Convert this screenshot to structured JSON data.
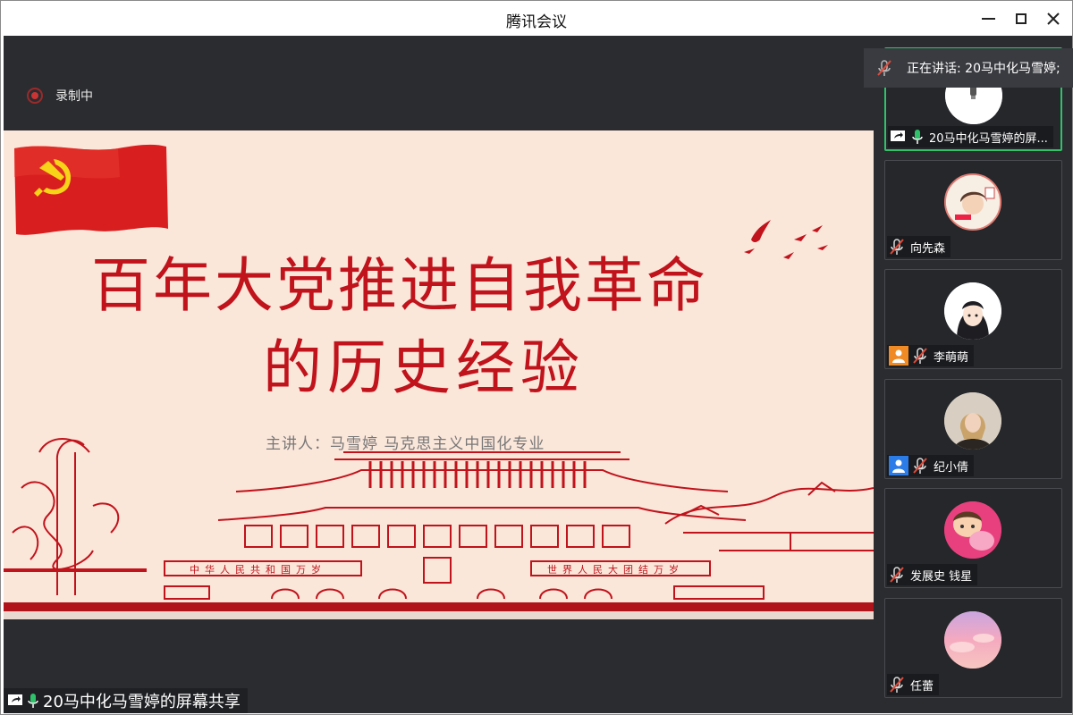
{
  "window": {
    "title": "腾讯会议"
  },
  "recording": {
    "label": "录制中"
  },
  "slide": {
    "title_line1": "百年大党推进自我革命",
    "title_line2": "的历史经验",
    "speaker": "主讲人：马雪婷   马克思主义中国化专业",
    "banner_left": "中华人民共和国万岁",
    "banner_right": "世界人民大团结万岁"
  },
  "share_label": "20马中化马雪婷的屏幕共享",
  "speaking": {
    "label": "正在讲话: 20马中化马雪婷;"
  },
  "participants": [
    {
      "name": "20马中化马雪婷的屏...",
      "mic": "on",
      "sharing": true
    },
    {
      "name": "向先森",
      "mic": "off"
    },
    {
      "name": "李萌萌",
      "mic": "off",
      "badge": "orange"
    },
    {
      "name": "纪小倩",
      "mic": "off",
      "badge": "blue"
    },
    {
      "name": "发展史 钱星",
      "mic": "off"
    },
    {
      "name": "任蕾",
      "mic": "off"
    }
  ],
  "colors": {
    "accent_green": "#2fc26b",
    "slide_red": "#c0131b",
    "stage_bg": "#2b2c30"
  }
}
